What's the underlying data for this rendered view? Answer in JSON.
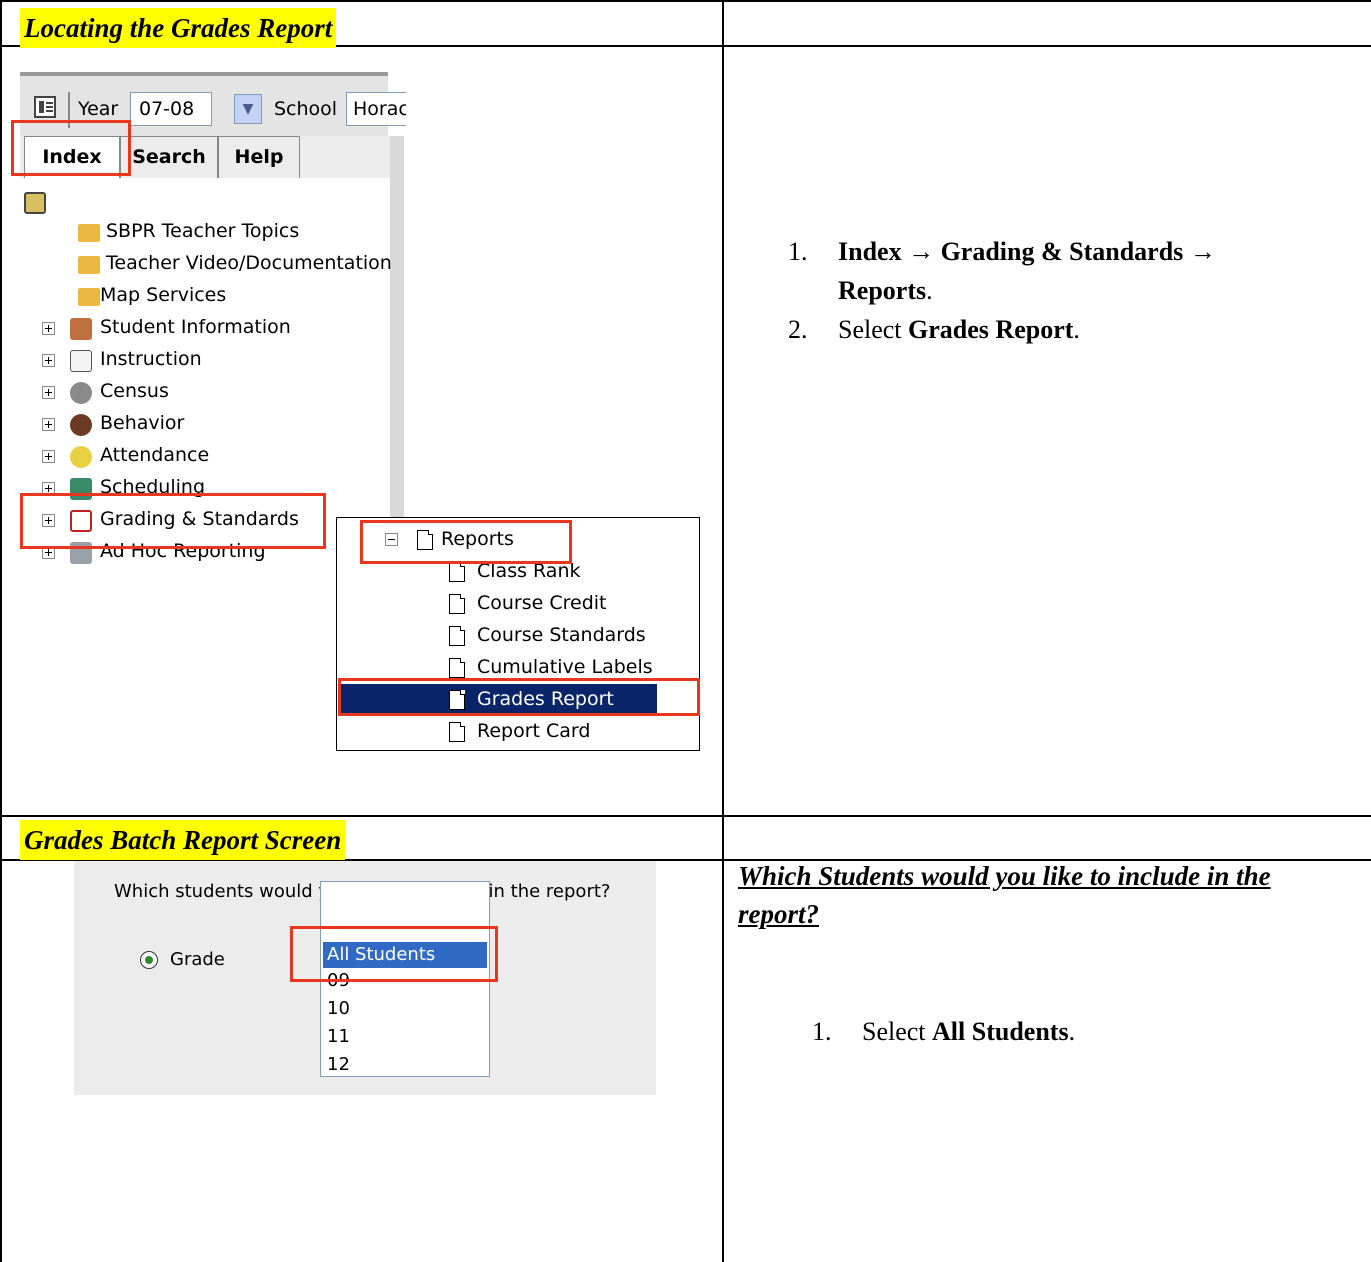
{
  "section1": {
    "title": "Locating the Grades Report",
    "toolbar": {
      "year_label": "Year",
      "year_value": "07-08",
      "school_label": "School",
      "school_value": "Horac"
    },
    "tabs": [
      "Index",
      "Search",
      "Help"
    ],
    "tree": [
      "SBPR Teacher Topics",
      "Teacher Video/Documentation",
      "Map Services",
      "Student Information",
      "Instruction",
      "Census",
      "Behavior",
      "Attendance",
      "Scheduling",
      "Grading & Standards",
      "Ad Hoc Reporting"
    ],
    "reports_menu": {
      "header": "Reports",
      "items": [
        "Class Rank",
        "Course Credit",
        "Course Standards",
        "Cumulative Labels",
        "Grades Report",
        "Report Card"
      ],
      "selected": "Grades Report"
    },
    "steps": [
      {
        "num": "1.",
        "parts": [
          "Index",
          "→",
          "Grading & Standards",
          "→",
          "Reports",
          "."
        ]
      },
      {
        "num": "2.",
        "parts": [
          "Select ",
          "Grades Report",
          "."
        ]
      }
    ]
  },
  "section2": {
    "title": "Grades Batch Report Screen",
    "prompt": "Which students would you like to include in the report?",
    "radio_label": "Grade",
    "grade_options": [
      "All Students",
      "09",
      "10",
      "11",
      "12"
    ],
    "question": "Which Students would you like to include in the report?",
    "steps": [
      {
        "num": "1.",
        "parts": [
          "Select ",
          "All Students",
          "."
        ]
      }
    ]
  }
}
